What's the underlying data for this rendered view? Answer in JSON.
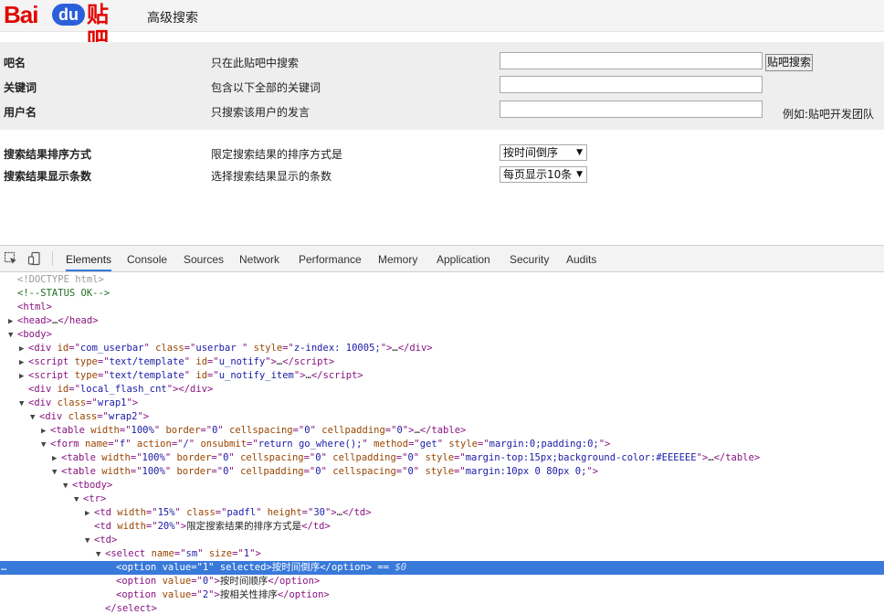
{
  "logo": {
    "part1": "Bai",
    "part2": "du",
    "part3": "贴吧"
  },
  "page_title": "高级搜索",
  "form": {
    "rows": [
      {
        "label": "吧名",
        "desc": "只在此贴吧中搜索",
        "value": ""
      },
      {
        "label": "关键词",
        "desc": "包含以下全部的关键词",
        "value": ""
      },
      {
        "label": "用户名",
        "desc": "只搜索该用户的发言",
        "value": ""
      }
    ],
    "search_button": "贴吧搜索",
    "example_hint": "例如:贴吧开发团队",
    "sort": {
      "label": "搜索结果排序方式",
      "desc": "限定搜索结果的排序方式是",
      "selected": "按时间倒序"
    },
    "count": {
      "label": "搜索结果显示条数",
      "desc": "选择搜索结果显示的条数",
      "selected": "每页显示10条"
    }
  },
  "devtools": {
    "tabs": [
      "Elements",
      "Console",
      "Sources",
      "Network",
      "Performance",
      "Memory",
      "Application",
      "Security",
      "Audits"
    ],
    "active_tab": "Elements",
    "tree": [
      {
        "tri": "",
        "ind": 0,
        "cls": "dt",
        "html": "&lt;!DOCTYPE html&gt;"
      },
      {
        "tri": "",
        "ind": 0,
        "cls": "cm",
        "html": "&lt;!--STATUS OK--&gt;"
      },
      {
        "tri": "",
        "ind": 0,
        "cls": "t",
        "html": "&lt;html&gt;"
      },
      {
        "tri": "▶",
        "ind": 0,
        "html": "<span class='t'>&lt;head&gt;</span><span class='tx'>…</span><span class='t'>&lt;/head&gt;</span>"
      },
      {
        "tri": "▼",
        "ind": 0,
        "html": "<span class='t'>&lt;body&gt;</span>"
      },
      {
        "tri": "▶",
        "ind": 1,
        "html": "<span class='t'>&lt;div </span><span class='an'>id</span><span class='t'>=\"</span><span class='av'>com_userbar</span><span class='t'>\" </span><span class='an'>class</span><span class='t'>=\"</span><span class='av'>userbar </span><span class='t'>\" </span><span class='an'>style</span><span class='t'>=\"</span><span class='av'>z-index: 10005;</span><span class='t'>\"&gt;</span><span class='tx'>…</span><span class='t'>&lt;/div&gt;</span>"
      },
      {
        "tri": "▶",
        "ind": 1,
        "html": "<span class='t'>&lt;script </span><span class='an'>type</span><span class='t'>=\"</span><span class='av'>text/template</span><span class='t'>\" </span><span class='an'>id</span><span class='t'>=\"</span><span class='av'>u_notify</span><span class='t'>\"&gt;</span><span class='tx'>…</span><span class='t'>&lt;/script&gt;</span>"
      },
      {
        "tri": "▶",
        "ind": 1,
        "html": "<span class='t'>&lt;script </span><span class='an'>type</span><span class='t'>=\"</span><span class='av'>text/template</span><span class='t'>\" </span><span class='an'>id</span><span class='t'>=\"</span><span class='av'>u_notify_item</span><span class='t'>\"&gt;</span><span class='tx'>…</span><span class='t'>&lt;/script&gt;</span>"
      },
      {
        "tri": "",
        "ind": 1,
        "html": "<span class='t'>&lt;div </span><span class='an'>id</span><span class='t'>=\"</span><span class='av'>local_flash_cnt</span><span class='t'>\"&gt;&lt;/div&gt;</span>"
      },
      {
        "tri": "▼",
        "ind": 1,
        "html": "<span class='t'>&lt;div </span><span class='an'>class</span><span class='t'>=\"</span><span class='av'>wrap1</span><span class='t'>\"&gt;</span>"
      },
      {
        "tri": "▼",
        "ind": 2,
        "html": "<span class='t'>&lt;div </span><span class='an'>class</span><span class='t'>=\"</span><span class='av'>wrap2</span><span class='t'>\"&gt;</span>"
      },
      {
        "tri": "▶",
        "ind": 3,
        "html": "<span class='t'>&lt;table </span><span class='an'>width</span><span class='t'>=\"</span><span class='av'>100%</span><span class='t'>\" </span><span class='an'>border</span><span class='t'>=\"</span><span class='av'>0</span><span class='t'>\" </span><span class='an'>cellspacing</span><span class='t'>=\"</span><span class='av'>0</span><span class='t'>\" </span><span class='an'>cellpadding</span><span class='t'>=\"</span><span class='av'>0</span><span class='t'>\"&gt;</span><span class='tx'>…</span><span class='t'>&lt;/table&gt;</span>"
      },
      {
        "tri": "▼",
        "ind": 3,
        "html": "<span class='t'>&lt;form </span><span class='an'>name</span><span class='t'>=\"</span><span class='av'>f</span><span class='t'>\" </span><span class='an'>action</span><span class='t'>=\"</span><span class='av'>/</span><span class='t'>\" </span><span class='an'>onsubmit</span><span class='t'>=\"</span><span class='av'>return go_where();</span><span class='t'>\" </span><span class='an'>method</span><span class='t'>=\"</span><span class='av'>get</span><span class='t'>\" </span><span class='an'>style</span><span class='t'>=\"</span><span class='av'>margin:0;padding:0;</span><span class='t'>\"&gt;</span>"
      },
      {
        "tri": "▶",
        "ind": 4,
        "html": "<span class='t'>&lt;table </span><span class='an'>width</span><span class='t'>=\"</span><span class='av'>100%</span><span class='t'>\" </span><span class='an'>border</span><span class='t'>=\"</span><span class='av'>0</span><span class='t'>\" </span><span class='an'>cellspacing</span><span class='t'>=\"</span><span class='av'>0</span><span class='t'>\" </span><span class='an'>cellpadding</span><span class='t'>=\"</span><span class='av'>0</span><span class='t'>\" </span><span class='an'>style</span><span class='t'>=\"</span><span class='av'>margin-top:15px;background-color:#EEEEEE</span><span class='t'>\"&gt;</span><span class='tx'>…</span><span class='t'>&lt;/table&gt;</span>"
      },
      {
        "tri": "▼",
        "ind": 4,
        "html": "<span class='t'>&lt;table </span><span class='an'>width</span><span class='t'>=\"</span><span class='av'>100%</span><span class='t'>\" </span><span class='an'>border</span><span class='t'>=\"</span><span class='av'>0</span><span class='t'>\" </span><span class='an'>cellpadding</span><span class='t'>=\"</span><span class='av'>0</span><span class='t'>\" </span><span class='an'>cellspacing</span><span class='t'>=\"</span><span class='av'>0</span><span class='t'>\" </span><span class='an'>style</span><span class='t'>=\"</span><span class='av'>margin:10px 0 80px 0;</span><span class='t'>\"&gt;</span>"
      },
      {
        "tri": "▼",
        "ind": 5,
        "html": "<span class='t'>&lt;tbody&gt;</span>"
      },
      {
        "tri": "▼",
        "ind": 6,
        "html": "<span class='t'>&lt;tr&gt;</span>"
      },
      {
        "tri": "▶",
        "ind": 7,
        "html": "<span class='t'>&lt;td </span><span class='an'>width</span><span class='t'>=\"</span><span class='av'>15%</span><span class='t'>\" </span><span class='an'>class</span><span class='t'>=\"</span><span class='av'>padfl</span><span class='t'>\" </span><span class='an'>height</span><span class='t'>=\"</span><span class='av'>30</span><span class='t'>\"&gt;</span><span class='tx'>…</span><span class='t'>&lt;/td&gt;</span>"
      },
      {
        "tri": "",
        "ind": 7,
        "html": "<span class='t'>&lt;td </span><span class='an'>width</span><span class='t'>=\"</span><span class='av'>20%</span><span class='t'>\"&gt;</span><span class='tx'>限定搜索结果的排序方式是</span><span class='t'>&lt;/td&gt;</span>"
      },
      {
        "tri": "▼",
        "ind": 7,
        "html": "<span class='t'>&lt;td&gt;</span>"
      },
      {
        "tri": "▼",
        "ind": 8,
        "html": "<span class='t'>&lt;select </span><span class='an'>name</span><span class='t'>=\"</span><span class='av'>sm</span><span class='t'>\" </span><span class='an'>size</span><span class='t'>=\"</span><span class='av'>1</span><span class='t'>\"&gt;</span>"
      },
      {
        "tri": "",
        "ind": 9,
        "selected": true,
        "html": "<span class='t'>&lt;option </span><span class='an'>value</span><span class='t'>=\"</span><span class='av'>1</span><span class='t'>\" </span><span class='an'>selected</span><span class='t'>&gt;</span><span class='tx'>按时间倒序</span><span class='t'>&lt;/option&gt;</span><span class='tx'> == </span><span class='dollar'>$0</span>"
      },
      {
        "tri": "",
        "ind": 9,
        "html": "<span class='t'>&lt;option </span><span class='an'>value</span><span class='t'>=\"</span><span class='av'>0</span><span class='t'>\"&gt;</span><span class='tx'>按时间顺序</span><span class='t'>&lt;/option&gt;</span>"
      },
      {
        "tri": "",
        "ind": 9,
        "html": "<span class='t'>&lt;option </span><span class='an'>value</span><span class='t'>=\"</span><span class='av'>2</span><span class='t'>\"&gt;</span><span class='tx'>按相关性排序</span><span class='t'>&lt;/option&gt;</span>"
      },
      {
        "tri": "",
        "ind": 8,
        "html": "<span class='t'>&lt;/select&gt;</span>"
      }
    ]
  }
}
